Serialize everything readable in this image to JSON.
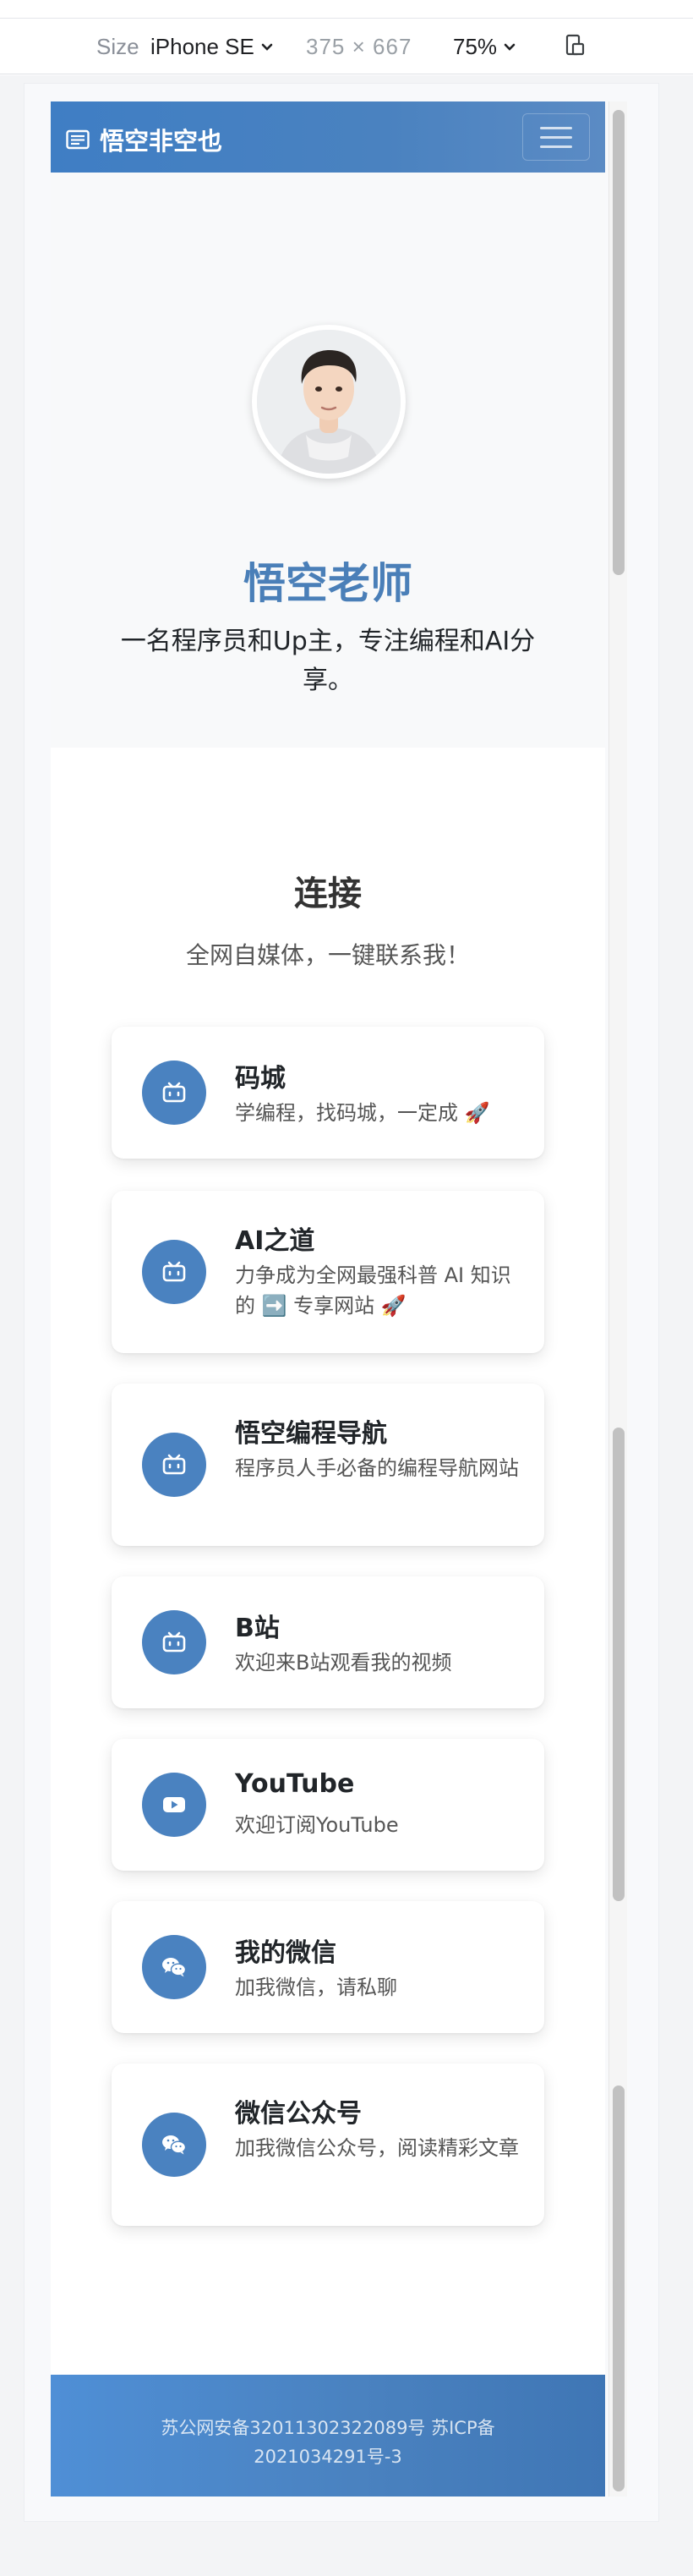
{
  "devtools": {
    "size_label": "Size",
    "device": "iPhone SE",
    "width": "375",
    "times": "×",
    "height": "667",
    "zoom": "75%"
  },
  "navbar": {
    "brand": "悟空非空也",
    "brand_icon": "document-icon",
    "toggler_icon": "hamburger-icon"
  },
  "hero": {
    "name": "悟空老师",
    "bio": "一名程序员和Up主，专注编程和AI分享。"
  },
  "connect": {
    "title": "连接",
    "subtitle": "全网自媒体，一键联系我！",
    "cards": [
      {
        "title": "码城",
        "desc": "学编程，找码城，一定成 🚀",
        "icon": "bilibili-tv-icon"
      },
      {
        "title": "AI之道",
        "desc": "力争成为全网最强科普 AI 知识的 ➡️ 专享网站 🚀",
        "icon": "bilibili-tv-icon"
      },
      {
        "title": "悟空编程导航",
        "desc": "程序员人手必备的编程导航网站",
        "icon": "bilibili-tv-icon"
      },
      {
        "title": "B站",
        "desc": "欢迎来B站观看我的视频",
        "icon": "bilibili-tv-icon"
      },
      {
        "title": "YouTube",
        "desc": "欢迎订阅YouTube",
        "icon": "youtube-icon"
      },
      {
        "title": "我的微信",
        "desc": "加我微信，请私聊",
        "icon": "wechat-icon"
      },
      {
        "title": "微信公众号",
        "desc": "加我微信公众号，阅读精彩文章",
        "icon": "wechat-icon"
      }
    ]
  },
  "footer": {
    "text": "苏公网安备32011302322089号 苏ICP备2021034291号-3"
  },
  "colors": {
    "accent": "#4a82c0",
    "name": "#4a7fb8",
    "background": "#f8f9fa"
  }
}
